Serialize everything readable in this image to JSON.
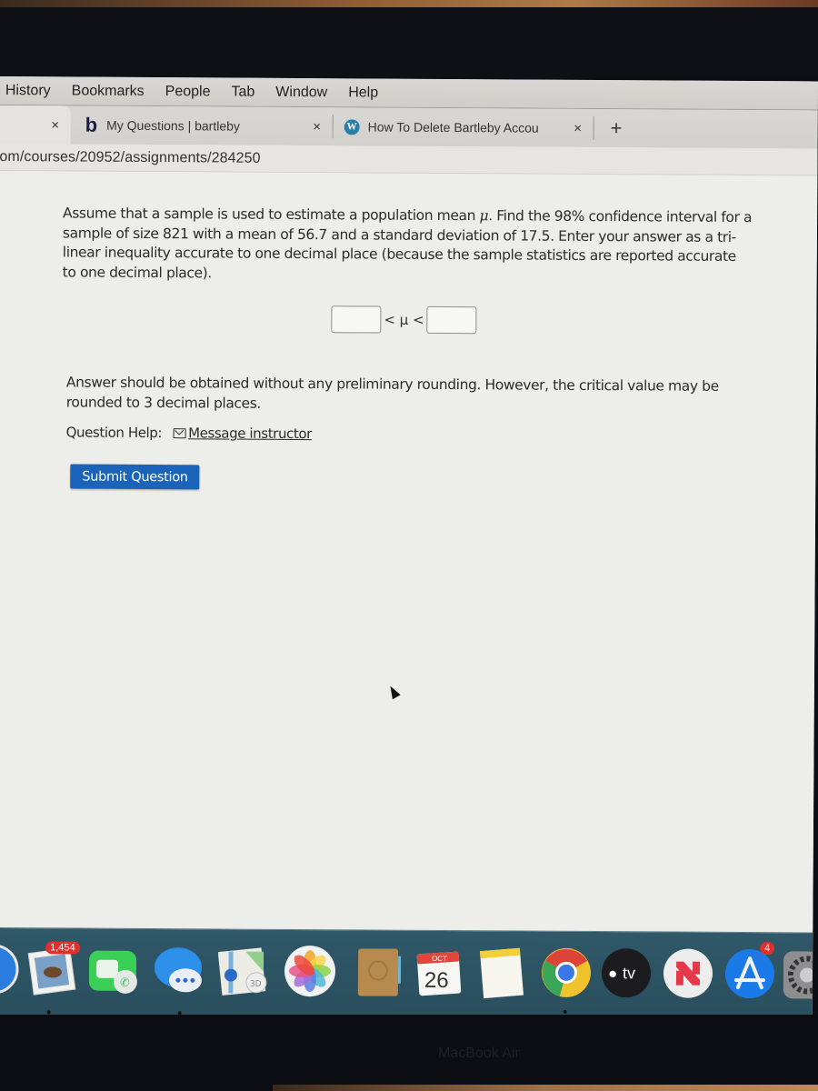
{
  "menubar": {
    "items": [
      "History",
      "Bookmarks",
      "People",
      "Tab",
      "Window",
      "Help"
    ]
  },
  "tabs": [
    {
      "label": "",
      "active": true
    },
    {
      "label": "My Questions | bartleby",
      "icon": "bartleby-logo-icon",
      "favicon_text": "b"
    },
    {
      "label": "How To Delete Bartleby Accou",
      "icon": "wordpress-logo-icon",
      "favicon_text": "W"
    }
  ],
  "new_tab_label": "+",
  "close_label": "×",
  "url": "om/courses/20952/assignments/284250",
  "question": {
    "text_before_mu": "Assume that a sample is used to estimate a population mean ",
    "mu": "μ",
    "text_after_mu": ". Find the 98% confidence interval for a sample of size 821 with a mean of 56.7 and a standard deviation of 17.5. Enter your answer as a tri-linear inequality accurate to one decimal place (because the sample statistics are reported accurate to one decimal place).",
    "inequality": "< μ <",
    "lower_bound_value": "",
    "upper_bound_value": "",
    "note": "Answer should be obtained without any preliminary rounding. However, the critical value may be rounded to 3 decimal places.",
    "help_label": "Question Help:",
    "help_link": "Message instructor",
    "submit_label": "Submit Question"
  },
  "dock": {
    "items": [
      {
        "name": "safari",
        "icon": "safari-icon"
      },
      {
        "name": "mail",
        "icon": "mail-stamp-icon",
        "badge": "1,454"
      },
      {
        "name": "facetime",
        "icon": "facetime-icon"
      },
      {
        "name": "messages",
        "icon": "messages-icon"
      },
      {
        "name": "maps",
        "icon": "maps-icon",
        "label": "3D"
      },
      {
        "name": "photos",
        "icon": "photos-icon"
      },
      {
        "name": "contacts",
        "icon": "contacts-icon"
      },
      {
        "name": "calendar",
        "icon": "calendar-icon",
        "month": "OCT",
        "day": "26"
      },
      {
        "name": "notes",
        "icon": "notes-icon"
      },
      {
        "name": "chrome",
        "icon": "chrome-icon"
      },
      {
        "name": "apple-tv",
        "icon": "apple-tv-icon",
        "label": "tv"
      },
      {
        "name": "news",
        "icon": "news-icon"
      },
      {
        "name": "app-store",
        "icon": "app-store-icon",
        "badge": "4"
      },
      {
        "name": "system-preferences",
        "icon": "gear-icon"
      }
    ]
  },
  "bezel_label": "MacBook Air",
  "colors": {
    "submit_button": "#1a63b8",
    "dock": "#2c5262",
    "badge": "#e0302c"
  }
}
